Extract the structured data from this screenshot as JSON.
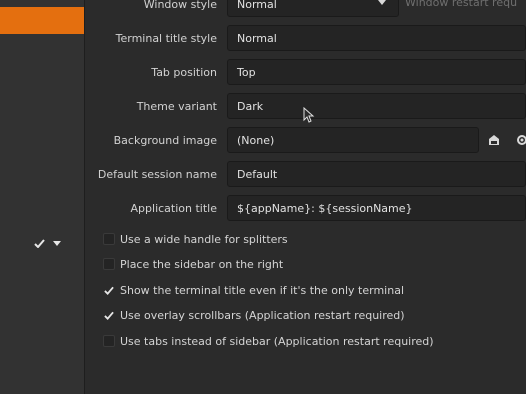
{
  "settings": {
    "window_style": {
      "label": "Window style",
      "value": "Normal",
      "note": "Window restart requ"
    },
    "terminal_title_style": {
      "label": "Terminal title style",
      "value": "Normal"
    },
    "tab_position": {
      "label": "Tab position",
      "value": "Top"
    },
    "theme_variant": {
      "label": "Theme variant",
      "value": "Dark"
    },
    "background_image": {
      "label": "Background image",
      "value": "(None)"
    },
    "default_session_name": {
      "label": "Default session name",
      "value": "Default"
    },
    "application_title": {
      "label": "Application title",
      "value": "${appName}: ${sessionName}"
    }
  },
  "checkboxes": [
    {
      "label": "Use a wide handle for splitters",
      "checked": false
    },
    {
      "label": "Place the sidebar on the right",
      "checked": false
    },
    {
      "label": "Show the terminal title even if it's the only terminal",
      "checked": true
    },
    {
      "label": "Use overlay scrollbars (Application restart required)",
      "checked": true
    },
    {
      "label": "Use tabs instead of sidebar (Application restart required)",
      "checked": false
    }
  ],
  "colors": {
    "accent": "#e46f0f",
    "background": "#2b2b2b",
    "field": "#242424"
  }
}
